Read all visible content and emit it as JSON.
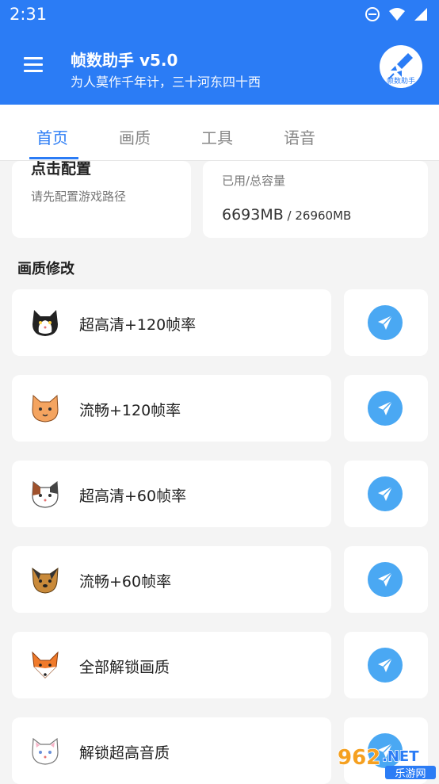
{
  "status": {
    "time": "2:31"
  },
  "app": {
    "title": "帧数助手 v5.0",
    "subtitle": "为人莫作千年计，三十河东四十西",
    "logo_text": "帧数助手"
  },
  "tabs": [
    "首页",
    "画质",
    "工具",
    "语音"
  ],
  "config_card": {
    "title": "点击配置",
    "subtitle": "请先配置游戏路径"
  },
  "storage_card": {
    "label": "已用/总容量",
    "used": "6693MB",
    "total": " / 26960MB"
  },
  "section_title": "画质修改",
  "items": [
    {
      "label": "超高清+120帧率",
      "icon": "tuxedo-cat-icon"
    },
    {
      "label": "流畅+120帧率",
      "icon": "orange-cat-icon"
    },
    {
      "label": "超高清+60帧率",
      "icon": "calico-cat-icon"
    },
    {
      "label": "流畅+60帧率",
      "icon": "yorkie-dog-icon"
    },
    {
      "label": "全部解锁画质",
      "icon": "fox-icon"
    },
    {
      "label": "解锁超高音质",
      "icon": "white-cat-icon"
    }
  ],
  "watermark": {
    "main": "962.NET",
    "sub": "乐游网"
  },
  "colors": {
    "primary": "#2b7cf5",
    "send": "#4aa8f3"
  }
}
